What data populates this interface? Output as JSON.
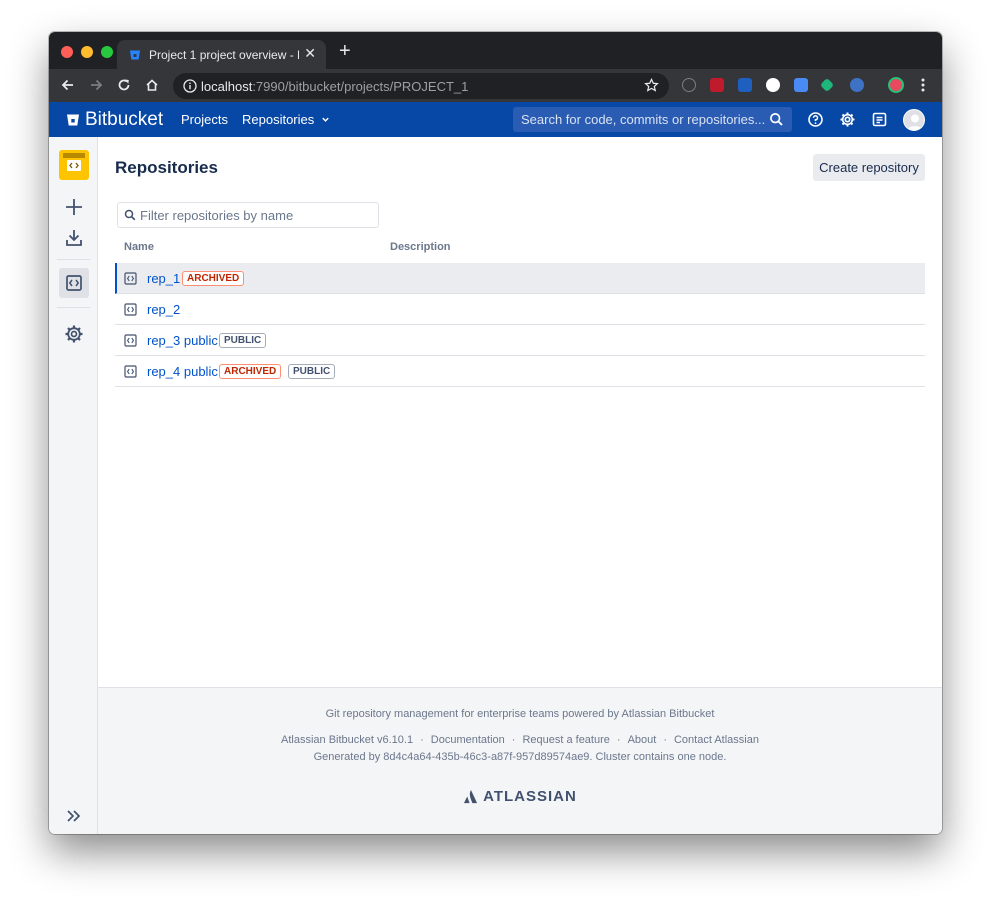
{
  "browser": {
    "tab_title": "Project 1 project overview - Bitbu",
    "url_host": "localhost",
    "url_rest": ":7990/bitbucket/projects/PROJECT_1"
  },
  "header": {
    "logo_text": "Bitbucket",
    "nav": {
      "projects": "Projects",
      "repositories": "Repositories"
    },
    "search_placeholder": "Search for code, commits or repositories..."
  },
  "main": {
    "title": "Repositories",
    "create_button": "Create repository",
    "filter_placeholder": "Filter repositories by name",
    "columns": {
      "name": "Name",
      "description": "Description"
    },
    "repos": [
      {
        "name": "rep_1",
        "archived": "ARCHIVED",
        "public": ""
      },
      {
        "name": "rep_2",
        "archived": "",
        "public": ""
      },
      {
        "name": "rep_3 public",
        "archived": "",
        "public": "PUBLIC"
      },
      {
        "name": "rep_4 public",
        "archived": "ARCHIVED",
        "public": "PUBLIC"
      }
    ]
  },
  "footer": {
    "tagline": "Git repository management for enterprise teams powered by Atlassian Bitbucket",
    "links": [
      "Atlassian Bitbucket v6.10.1",
      "Documentation",
      "Request a feature",
      "About",
      "Contact Atlassian"
    ],
    "separator": "·",
    "generated": "Generated by 8d4c4a64-435b-46c3-a87f-957d89574ae9. Cluster contains one node.",
    "brand": "ATLASSIAN"
  },
  "colors": {
    "header_bg": "#0747a6",
    "link": "#0052cc",
    "archived": "#bf2600",
    "project_avatar": "#ffc400"
  }
}
